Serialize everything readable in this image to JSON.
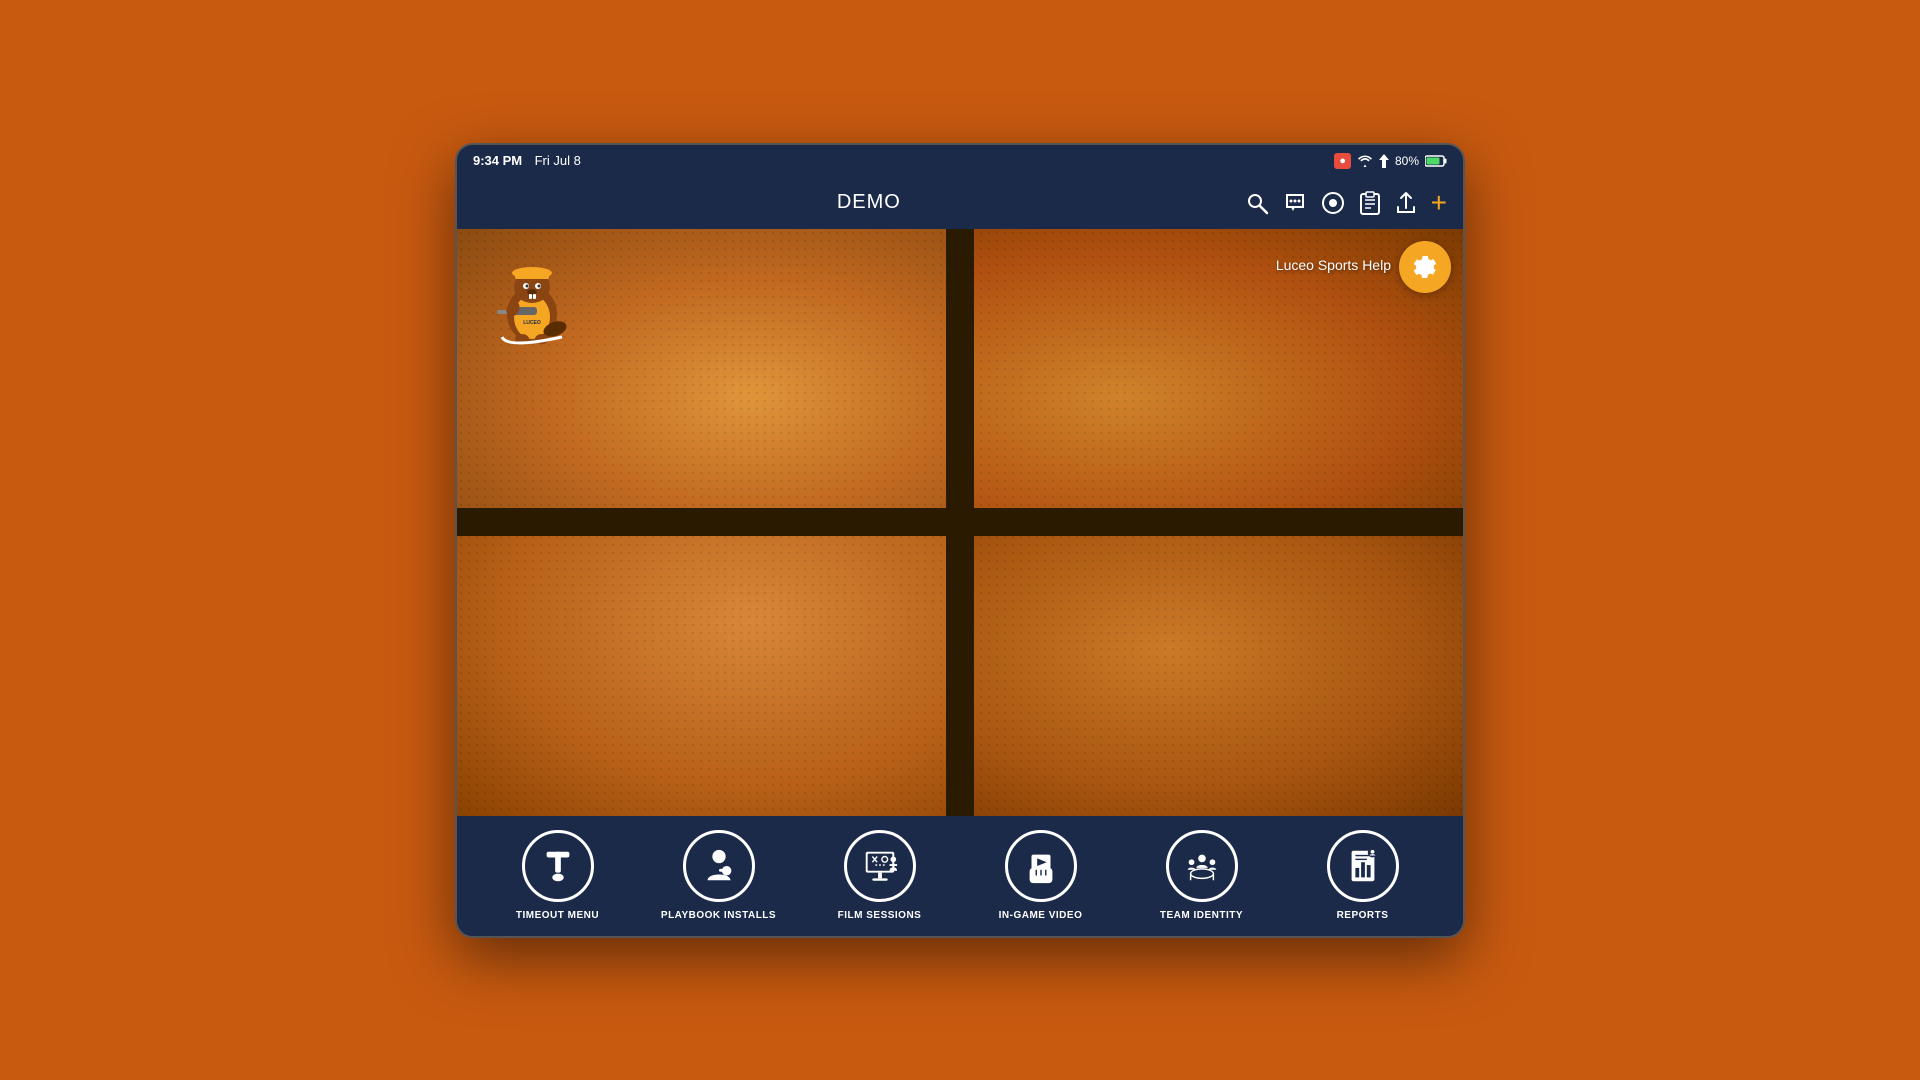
{
  "device": {
    "status_bar": {
      "time": "9:34 PM",
      "date": "Fri Jul 8",
      "battery_level": "80%",
      "battery_icon": "🔴"
    },
    "nav_bar": {
      "title": "DEMO",
      "icons": [
        "search",
        "chat",
        "record",
        "clipboard",
        "share",
        "plus"
      ]
    }
  },
  "app": {
    "title": "DEMO",
    "help_text": "Luceo Sports Help",
    "settings_icon": "⚙",
    "mascot_label": "LUCEO beaver mascot"
  },
  "menu": {
    "items": [
      {
        "id": "timeout-menu",
        "label": "TIMEOUT MENU",
        "icon": "timeout"
      },
      {
        "id": "playbook-installs",
        "label": "PLAYBOOK INSTALLS",
        "icon": "playbook"
      },
      {
        "id": "film-sessions",
        "label": "FILM SESSIONS",
        "icon": "film"
      },
      {
        "id": "in-game-video",
        "label": "IN-GAME VIDEO",
        "icon": "video"
      },
      {
        "id": "team-identity",
        "label": "TEAM IDENTITY",
        "icon": "team"
      },
      {
        "id": "reports",
        "label": "REPORTS",
        "icon": "reports"
      }
    ]
  },
  "colors": {
    "nav_bg": "#1c2a4a",
    "accent_orange": "#f5a623",
    "text_white": "#ffffff",
    "basketball_mid": "#c8711a"
  }
}
